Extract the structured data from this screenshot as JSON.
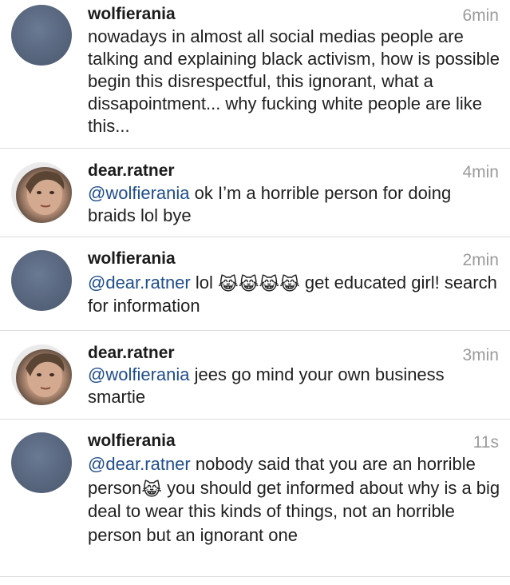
{
  "comments": [
    {
      "username": "wolfierania",
      "time": "6min",
      "text": "nowadays in almost all social medias people are talking and explaining black activism, how is possible begin this disrespectful, this ignorant, what a dissapointment... why fucking white people are like this..."
    },
    {
      "username": "dear.ratner",
      "time": "4min",
      "mention": "@wolfierania",
      "text": " ok I’m a horrible person for doing braids lol bye"
    },
    {
      "username": "wolfierania",
      "time": "2min",
      "mention": "@dear.ratner",
      "text_before": " lol ",
      "emoji": "😹😹😹😹",
      "text_after": " get educated girl! search for information"
    },
    {
      "username": "dear.ratner",
      "time": "3min",
      "mention": "@wolfierania",
      "text": " jees go mind your own business smartie"
    },
    {
      "username": "wolfierania",
      "time": "11s",
      "mention": "@dear.ratner",
      "text_before": " nobody said that you are an horrible person",
      "emoji": "😹",
      "text_after": " you should get informed about why is a big deal to wear this kinds of things, not an horrible person but an ignorant one"
    }
  ],
  "icons": {
    "moon_avatar": "crescent-moon-avatar",
    "face_avatar": "profile-photo-avatar"
  }
}
